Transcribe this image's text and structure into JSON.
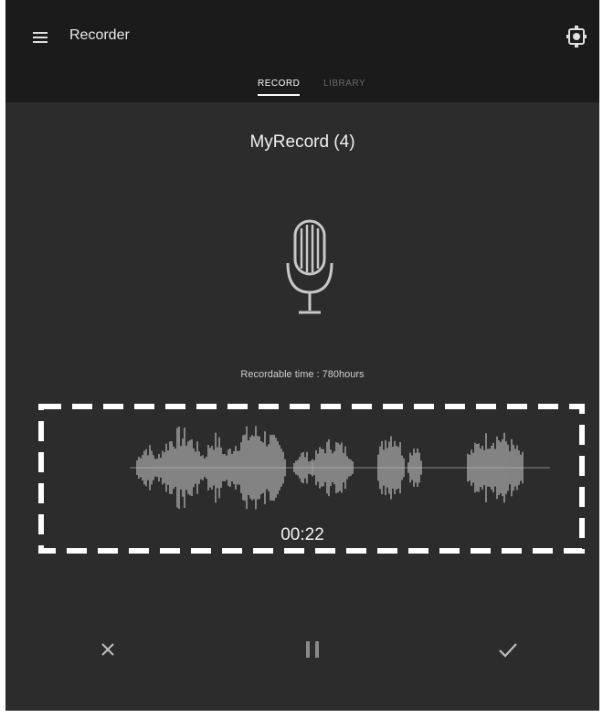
{
  "app": {
    "title": "Recorder",
    "menu_icon": "hamburger-menu-icon",
    "settings_icon": "settings-icon"
  },
  "tabs": [
    {
      "label": "RECORD",
      "active": true
    },
    {
      "label": "LIBRARY",
      "active": false
    }
  ],
  "recording": {
    "name": "MyRecord (4)",
    "recordable_time": "Recordable time : 780hours",
    "elapsed": "00:22",
    "mic_icon": "microphone-icon"
  },
  "controls": {
    "cancel_icon": "close-icon",
    "pause_icon": "pause-icon",
    "done_icon": "check-icon"
  },
  "colors": {
    "background": "#2c2c2c",
    "appbar": "#1b1b1b",
    "waveform": "#bdbdbd",
    "highlight_border": "#ffffff"
  }
}
